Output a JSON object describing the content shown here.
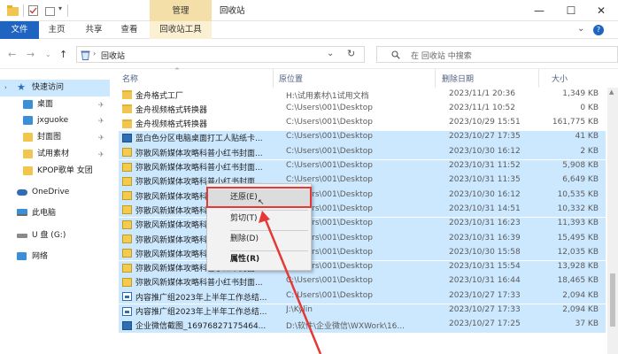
{
  "window": {
    "title": "回收站",
    "manage_tab": "管理",
    "controls": {
      "minimize": "—",
      "maximize": "☐",
      "close": "✕"
    }
  },
  "ribbon": {
    "tabs": [
      "文件",
      "主页",
      "共享",
      "查看",
      "回收站工具"
    ],
    "help": "?",
    "expand": "⌄"
  },
  "address": {
    "path": "回收站",
    "search_placeholder": "在 回收站 中搜索"
  },
  "sidebar": {
    "items": [
      {
        "label": "快速访问",
        "icon": "star-icon"
      },
      {
        "label": "桌面",
        "icon": "desktop-icon"
      },
      {
        "label": "jxguoke",
        "icon": "folder-icon"
      },
      {
        "label": "封面图",
        "icon": "folder-icon"
      },
      {
        "label": "试用素材",
        "icon": "folder-icon"
      },
      {
        "label": "KPOP歌单  女团",
        "icon": "folder-icon"
      },
      {
        "label": "OneDrive",
        "icon": "cloud-icon"
      },
      {
        "label": "此电脑",
        "icon": "computer-icon"
      },
      {
        "label": "U 盘 (G:)",
        "icon": "drive-icon"
      },
      {
        "label": "网络",
        "icon": "network-icon"
      }
    ]
  },
  "columns": {
    "name": "名称",
    "path": "原位置",
    "date": "删除日期",
    "size": "大小"
  },
  "files": [
    {
      "name": "金舟格式工厂",
      "path": "H:\\试用素材\\1试用文档",
      "date": "2023/11/1 20:36",
      "size": "1,349 KB",
      "type": "folder",
      "selected": false
    },
    {
      "name": "金舟视频格式转换器",
      "path": "C:\\Users\\001\\Desktop",
      "date": "2023/11/1 10:52",
      "size": "0 KB",
      "type": "folder",
      "selected": false
    },
    {
      "name": "金舟视频格式转换器",
      "path": "C:\\Users\\001\\Desktop",
      "date": "2023/10/29 15:51",
      "size": "161,775 KB",
      "type": "folder",
      "selected": false
    },
    {
      "name": "蓝白色分区电脑桌面打工人贴纸卡...",
      "path": "C:\\Users\\001\\Desktop",
      "date": "2023/10/27 17:35",
      "size": "41 KB",
      "type": "img",
      "selected": true
    },
    {
      "name": "弥散风新媒体攻略科普小红书封面...",
      "path": "C:\\Users\\001\\Desktop",
      "date": "2023/10/30 16:12",
      "size": "2 KB",
      "type": "zip",
      "selected": true
    },
    {
      "name": "弥散风新媒体攻略科普小红书封面...",
      "path": "C:\\Users\\001\\Desktop",
      "date": "2023/10/31 11:52",
      "size": "5,908 KB",
      "type": "zip",
      "selected": true
    },
    {
      "name": "弥散风新媒体攻略科普小红书封面...",
      "path": "C:\\Users\\001\\Desktop",
      "date": "2023/10/31 11:35",
      "size": "6,649 KB",
      "type": "zip",
      "selected": true
    },
    {
      "name": "弥散风新媒体攻略科普小红书封面...",
      "path": "C:\\Users\\001\\Desktop",
      "date": "2023/10/30 16:12",
      "size": "10,535 KB",
      "type": "zip",
      "selected": true
    },
    {
      "name": "弥散风新媒体攻略科普小红书封面...",
      "path": "C:\\Users\\001\\Desktop",
      "date": "2023/10/31 14:51",
      "size": "10,332 KB",
      "type": "zip",
      "selected": true
    },
    {
      "name": "弥散风新媒体攻略科普小红书封面...",
      "path": "C:\\Users\\001\\Desktop",
      "date": "2023/10/31 16:23",
      "size": "11,393 KB",
      "type": "zip",
      "selected": true
    },
    {
      "name": "弥散风新媒体攻略科普小红书封面...",
      "path": "C:\\Users\\001\\Desktop",
      "date": "2023/10/31 16:39",
      "size": "15,495 KB",
      "type": "zip",
      "selected": true
    },
    {
      "name": "弥散风新媒体攻略科普小红书封面...",
      "path": "C:\\Users\\001\\Desktop",
      "date": "2023/10/30 15:58",
      "size": "12,035 KB",
      "type": "zip",
      "selected": true
    },
    {
      "name": "弥散风新媒体攻略科普小红书封面...",
      "path": "C:\\Users\\001\\Desktop",
      "date": "2023/10/31 15:54",
      "size": "13,928 KB",
      "type": "zip",
      "selected": true
    },
    {
      "name": "弥散风新媒体攻略科普小红书封面...",
      "path": "C:\\Users\\001\\Desktop",
      "date": "2023/10/31 16:44",
      "size": "18,465 KB",
      "type": "zip",
      "selected": true
    },
    {
      "name": "内容推广组2023年上半年工作总结...",
      "path": "C:\\Users\\001\\Desktop",
      "date": "2023/10/27 17:33",
      "size": "2,094 KB",
      "type": "doc",
      "selected": true
    },
    {
      "name": "内容推广组2023年上半年工作总结...",
      "path": "J:\\Kylin",
      "date": "2023/10/27 17:33",
      "size": "2,094 KB",
      "type": "doc",
      "selected": true
    },
    {
      "name": "企业微信截图_16976827175464...",
      "path": "D:\\软件\\企业微信\\WXWork\\16...",
      "date": "2023/10/27 17:25",
      "size": "37 KB",
      "type": "img",
      "selected": true
    }
  ],
  "context_menu": {
    "restore": "还原(E)",
    "cut": "剪切(T)",
    "delete": "删除(D)",
    "properties": "属性(R)"
  },
  "colors": {
    "accent": "#1f64c0",
    "selection": "#cce8ff",
    "manage_tab": "#f4dfa9",
    "highlight": "#e53935"
  }
}
